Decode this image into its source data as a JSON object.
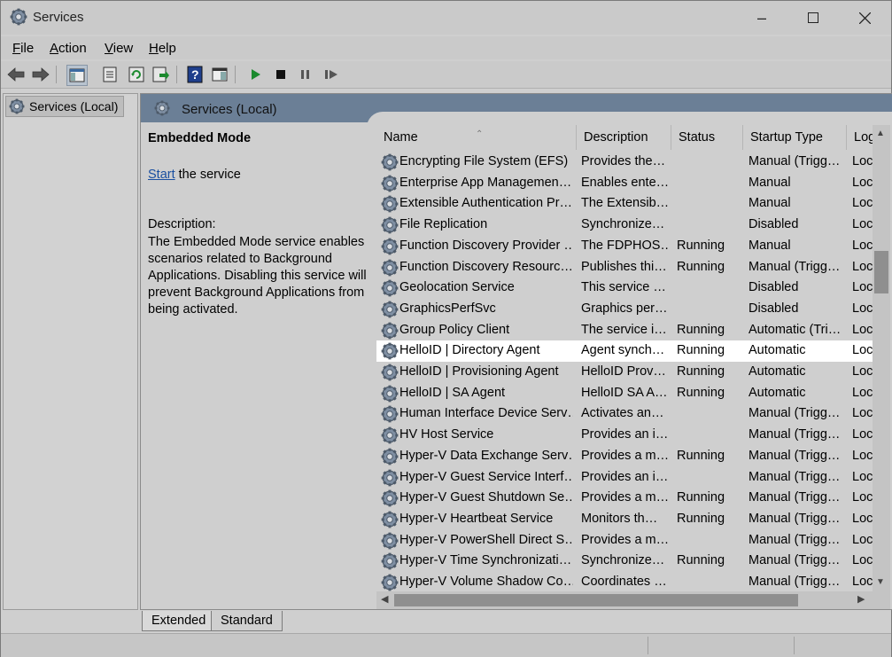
{
  "window": {
    "title": "Services"
  },
  "menu": [
    {
      "label": "File",
      "accel": "F",
      "rest": "ile"
    },
    {
      "label": "Action",
      "accel": "A",
      "rest": "ction"
    },
    {
      "label": "View",
      "accel": "V",
      "rest": "iew"
    },
    {
      "label": "Help",
      "accel": "H",
      "rest": "elp"
    }
  ],
  "toolbar": {
    "icons": [
      "back-arrow-icon",
      "forward-arrow-icon",
      "show-hide-console-tree-icon",
      "properties-icon",
      "refresh-icon",
      "export-list-icon",
      "help-icon",
      "show-hide-action-pane-icon",
      "start-service-icon",
      "stop-service-icon",
      "pause-service-icon",
      "restart-service-icon"
    ]
  },
  "tree": {
    "selected": "Services (Local)"
  },
  "panel": {
    "header": "Services (Local)",
    "extended": {
      "service_name": "Embedded Mode",
      "start_link": "Start",
      "start_suffix": " the service",
      "description_label": "Description:",
      "description": "The Embedded Mode service enables scenarios related to Background Applications.  Disabling this service will prevent Background Applications from being activated."
    }
  },
  "columns": [
    "Name",
    "Description",
    "Status",
    "Startup Type",
    "Log"
  ],
  "rows": [
    {
      "name": "Encrypting File System (EFS)",
      "description": "Provides the…",
      "status": "",
      "startup": "Manual (Trigg…",
      "logon": "Loc"
    },
    {
      "name": "Enterprise App Managemen…",
      "description": "Enables ente…",
      "status": "",
      "startup": "Manual",
      "logon": "Loc"
    },
    {
      "name": "Extensible Authentication Pr…",
      "description": "The Extensib…",
      "status": "",
      "startup": "Manual",
      "logon": "Loc"
    },
    {
      "name": "File Replication",
      "description": "Synchronize…",
      "status": "",
      "startup": "Disabled",
      "logon": "Loc"
    },
    {
      "name": "Function Discovery Provider …",
      "description": "The FDPHOS…",
      "status": "Running",
      "startup": "Manual",
      "logon": "Loc"
    },
    {
      "name": "Function Discovery Resourc…",
      "description": "Publishes thi…",
      "status": "Running",
      "startup": "Manual (Trigg…",
      "logon": "Loc"
    },
    {
      "name": "Geolocation Service",
      "description": "This service …",
      "status": "",
      "startup": "Disabled",
      "logon": "Loc"
    },
    {
      "name": "GraphicsPerfSvc",
      "description": "Graphics per…",
      "status": "",
      "startup": "Disabled",
      "logon": "Loc"
    },
    {
      "name": "Group Policy Client",
      "description": "The service i…",
      "status": "Running",
      "startup": "Automatic (Tri…",
      "logon": "Loc"
    },
    {
      "name": "HelloID | Directory Agent",
      "description": "Agent synch…",
      "status": "Running",
      "startup": "Automatic",
      "logon": "Loc",
      "selected": true
    },
    {
      "name": "HelloID | Provisioning Agent",
      "description": "HelloID Prov…",
      "status": "Running",
      "startup": "Automatic",
      "logon": "Loc"
    },
    {
      "name": "HelloID | SA Agent",
      "description": "HelloID SA A…",
      "status": "Running",
      "startup": "Automatic",
      "logon": "Loc"
    },
    {
      "name": "Human Interface Device Serv…",
      "description": "Activates an…",
      "status": "",
      "startup": "Manual (Trigg…",
      "logon": "Loc"
    },
    {
      "name": "HV Host Service",
      "description": "Provides an i…",
      "status": "",
      "startup": "Manual (Trigg…",
      "logon": "Loc"
    },
    {
      "name": "Hyper-V Data Exchange Serv…",
      "description": "Provides a m…",
      "status": "Running",
      "startup": "Manual (Trigg…",
      "logon": "Loc"
    },
    {
      "name": "Hyper-V Guest Service Interf…",
      "description": "Provides an i…",
      "status": "",
      "startup": "Manual (Trigg…",
      "logon": "Loc"
    },
    {
      "name": "Hyper-V Guest Shutdown Se…",
      "description": "Provides a m…",
      "status": "Running",
      "startup": "Manual (Trigg…",
      "logon": "Loc"
    },
    {
      "name": "Hyper-V Heartbeat Service",
      "description": "Monitors th…",
      "status": "Running",
      "startup": "Manual (Trigg…",
      "logon": "Loc"
    },
    {
      "name": "Hyper-V PowerShell Direct S…",
      "description": "Provides a m…",
      "status": "",
      "startup": "Manual (Trigg…",
      "logon": "Loc"
    },
    {
      "name": "Hyper-V Time Synchronizati…",
      "description": "Synchronize…",
      "status": "Running",
      "startup": "Manual (Trigg…",
      "logon": "Loc"
    },
    {
      "name": "Hyper-V Volume Shadow Co…",
      "description": "Coordinates …",
      "status": "",
      "startup": "Manual (Trigg…",
      "logon": "Loc"
    }
  ],
  "tabs": [
    "Extended",
    "Standard"
  ]
}
